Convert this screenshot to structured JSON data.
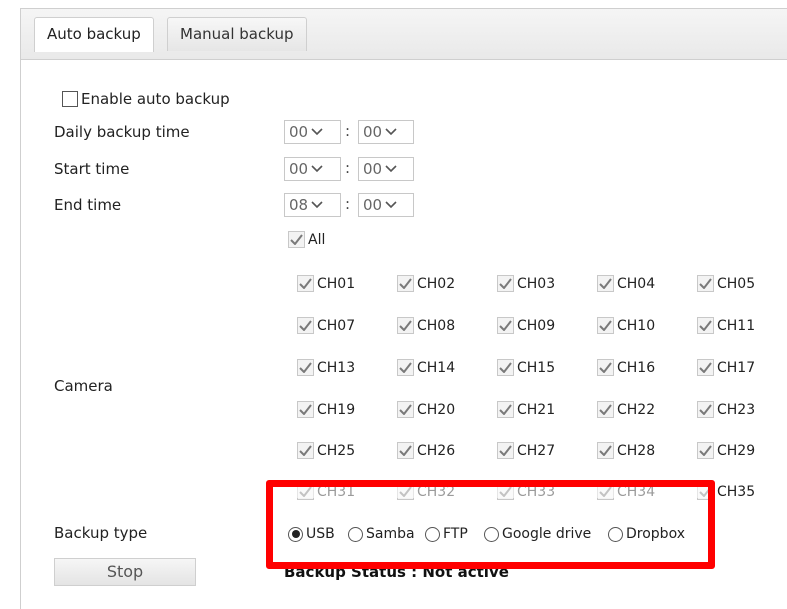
{
  "tabs": [
    {
      "label": "Auto backup",
      "active": true
    },
    {
      "label": "Manual backup",
      "active": false
    }
  ],
  "enable_label": "Enable auto backup",
  "daily": {
    "label": "Daily backup time",
    "hour": "00",
    "minute": "00",
    "sep": ":"
  },
  "start": {
    "label": "Start time",
    "hour": "00",
    "minute": "00",
    "sep": ":"
  },
  "end": {
    "label": "End time",
    "hour": "08",
    "minute": "00",
    "sep": ":"
  },
  "all_label": "All",
  "camera_label": "Camera",
  "channels": [
    "CH01",
    "CH02",
    "CH03",
    "CH04",
    "CH05",
    "CH07",
    "CH08",
    "CH09",
    "CH10",
    "CH11",
    "CH13",
    "CH14",
    "CH15",
    "CH16",
    "CH17",
    "CH19",
    "CH20",
    "CH21",
    "CH22",
    "CH23",
    "CH25",
    "CH26",
    "CH27",
    "CH28",
    "CH29",
    "CH31",
    "CH32",
    "CH33",
    "CH34",
    "CH35"
  ],
  "backup_type": {
    "label": "Backup type",
    "options": [
      "USB",
      "Samba",
      "FTP",
      "Google drive",
      "Dropbox"
    ],
    "selected": "USB"
  },
  "stop_label": "Stop",
  "status_text": "Backup Status : Not active",
  "colors": {
    "highlight": "#ff0000",
    "check": "#7a7a7a"
  }
}
